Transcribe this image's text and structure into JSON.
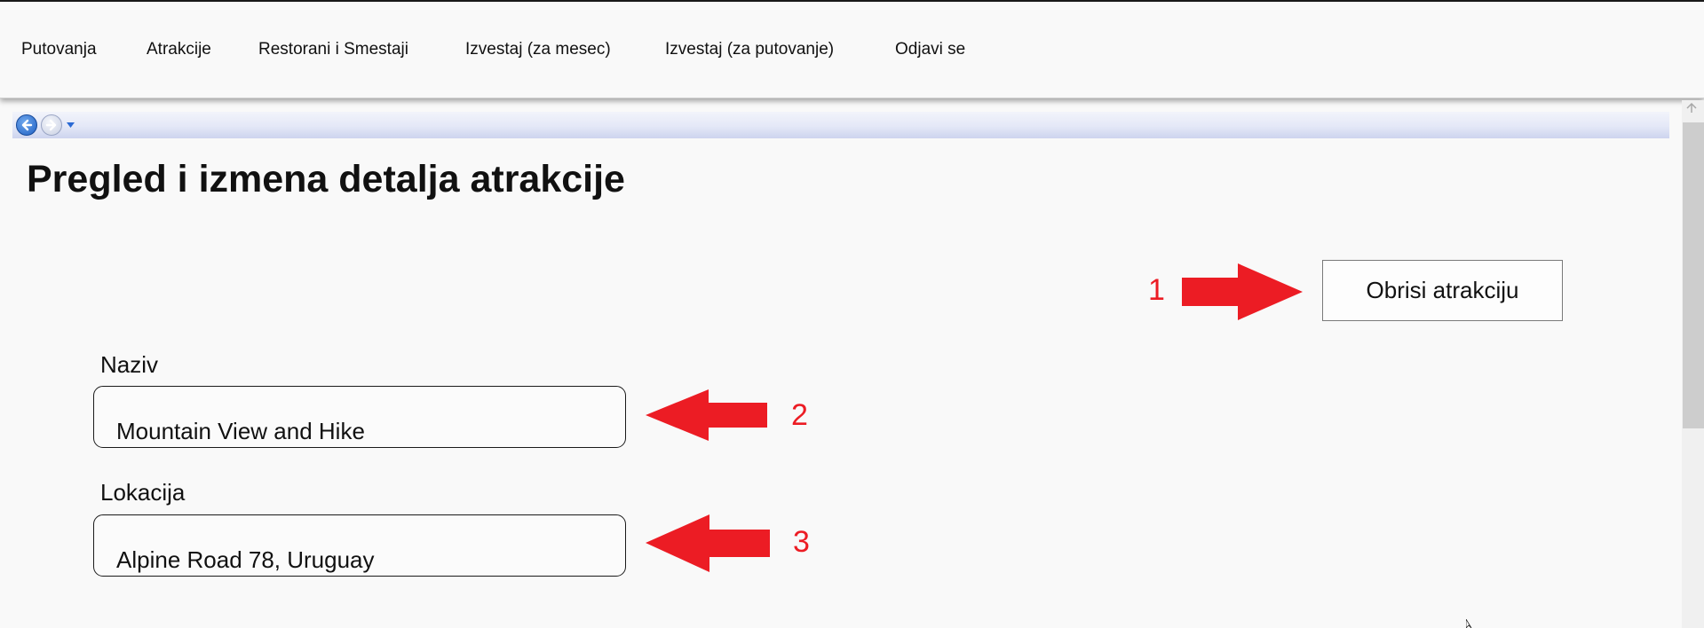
{
  "nav": {
    "items": [
      {
        "label": "Putovanja"
      },
      {
        "label": "Atrakcije"
      },
      {
        "label": "Restorani i Smestaji"
      },
      {
        "label": "Izvestaj (za mesec)"
      },
      {
        "label": "Izvestaj (za putovanje)"
      },
      {
        "label": "Odjavi se"
      }
    ]
  },
  "page": {
    "title": "Pregled i izmena detalja atrakcije"
  },
  "actions": {
    "delete_label": "Obrisi atrakciju"
  },
  "form": {
    "name_label": "Naziv",
    "name_value": "Mountain View and Hike",
    "location_label": "Lokacija",
    "location_value": "Alpine Road 78, Uruguay"
  },
  "annotations": {
    "one": "1",
    "two": "2",
    "three": "3",
    "color": "#ec1c24"
  },
  "icons": {
    "back": "back-arrow-icon",
    "forward": "forward-arrow-icon",
    "history_dropdown": "chevron-down-icon"
  }
}
